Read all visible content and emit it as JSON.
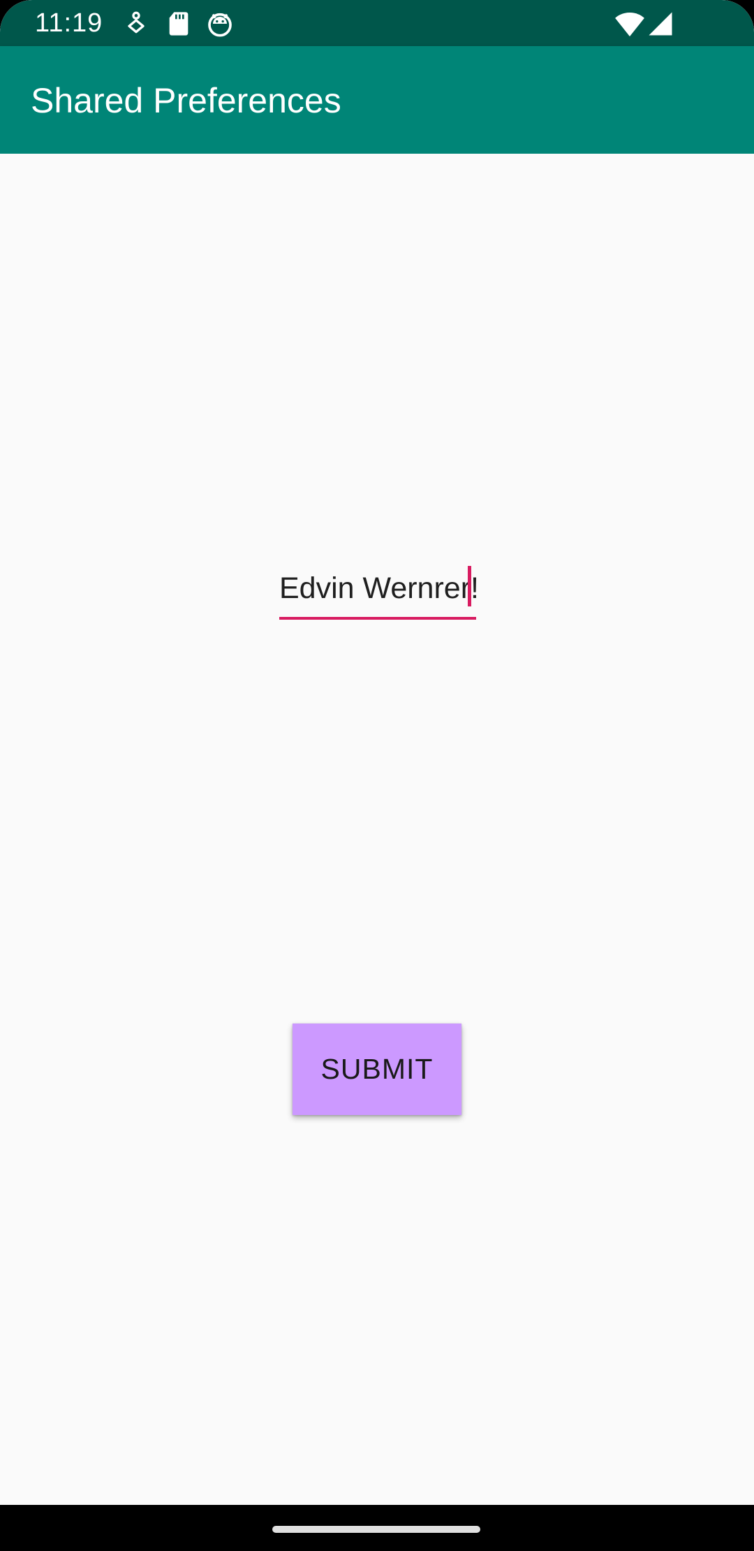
{
  "status_bar": {
    "time": "11:19",
    "left_icons": [
      "accessibility-icon",
      "sd-card-icon",
      "android-debug-icon"
    ],
    "right_icons": [
      "wifi-icon",
      "cellular-signal-icon"
    ]
  },
  "app_bar": {
    "title": "Shared Preferences"
  },
  "main": {
    "name_input": {
      "value": "Edvin Wernrer!"
    },
    "submit_button": {
      "label": "SUBMIT"
    }
  },
  "colors": {
    "status_bar": "#00574b",
    "app_bar": "#008577",
    "accent": "#d81b60",
    "button": "#cc99ff",
    "background": "#fafafa"
  }
}
